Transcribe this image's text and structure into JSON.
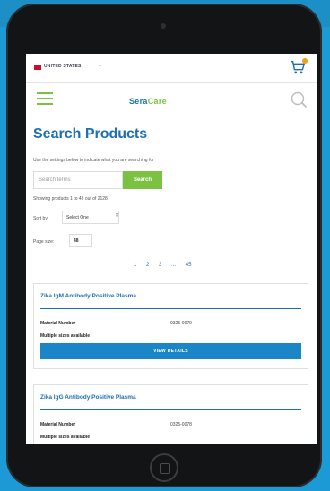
{
  "header": {
    "country": "UNITED STATES",
    "logo_main": "Sera",
    "logo_accent": "Care"
  },
  "page": {
    "title": "Search Products",
    "intro": "Use the settings below to indicate what you are searching for",
    "search_placeholder": "Search terms",
    "search_button": "Search",
    "showing": "Showing products 1 to 48 out of 2128",
    "sort_label": "Sort by:",
    "sort_value": "Select One",
    "page_size_label": "Page size:",
    "page_size_value": "48"
  },
  "pagination": [
    "1",
    "2",
    "3",
    "...",
    "45"
  ],
  "products": [
    {
      "name": "Zika IgM Antibody Positive Plasma",
      "material_label": "Material Number",
      "material_number": "0325-0079",
      "sizes": "Multiple sizes available",
      "button": "VIEW DETAILS"
    },
    {
      "name": "Zika IgG Antibody Positive Plasma",
      "material_label": "Material Number",
      "material_number": "0325-0078",
      "sizes": "Multiple sizes available"
    }
  ],
  "colors": {
    "brand_blue": "#1e6fb5",
    "brand_green": "#7cc242",
    "button_blue": "#1a86c8",
    "background": "#1b9ad6"
  },
  "icons": [
    "flag-icon",
    "chevron-down-icon",
    "cart-icon",
    "hamburger-menu-icon",
    "search-icon"
  ]
}
